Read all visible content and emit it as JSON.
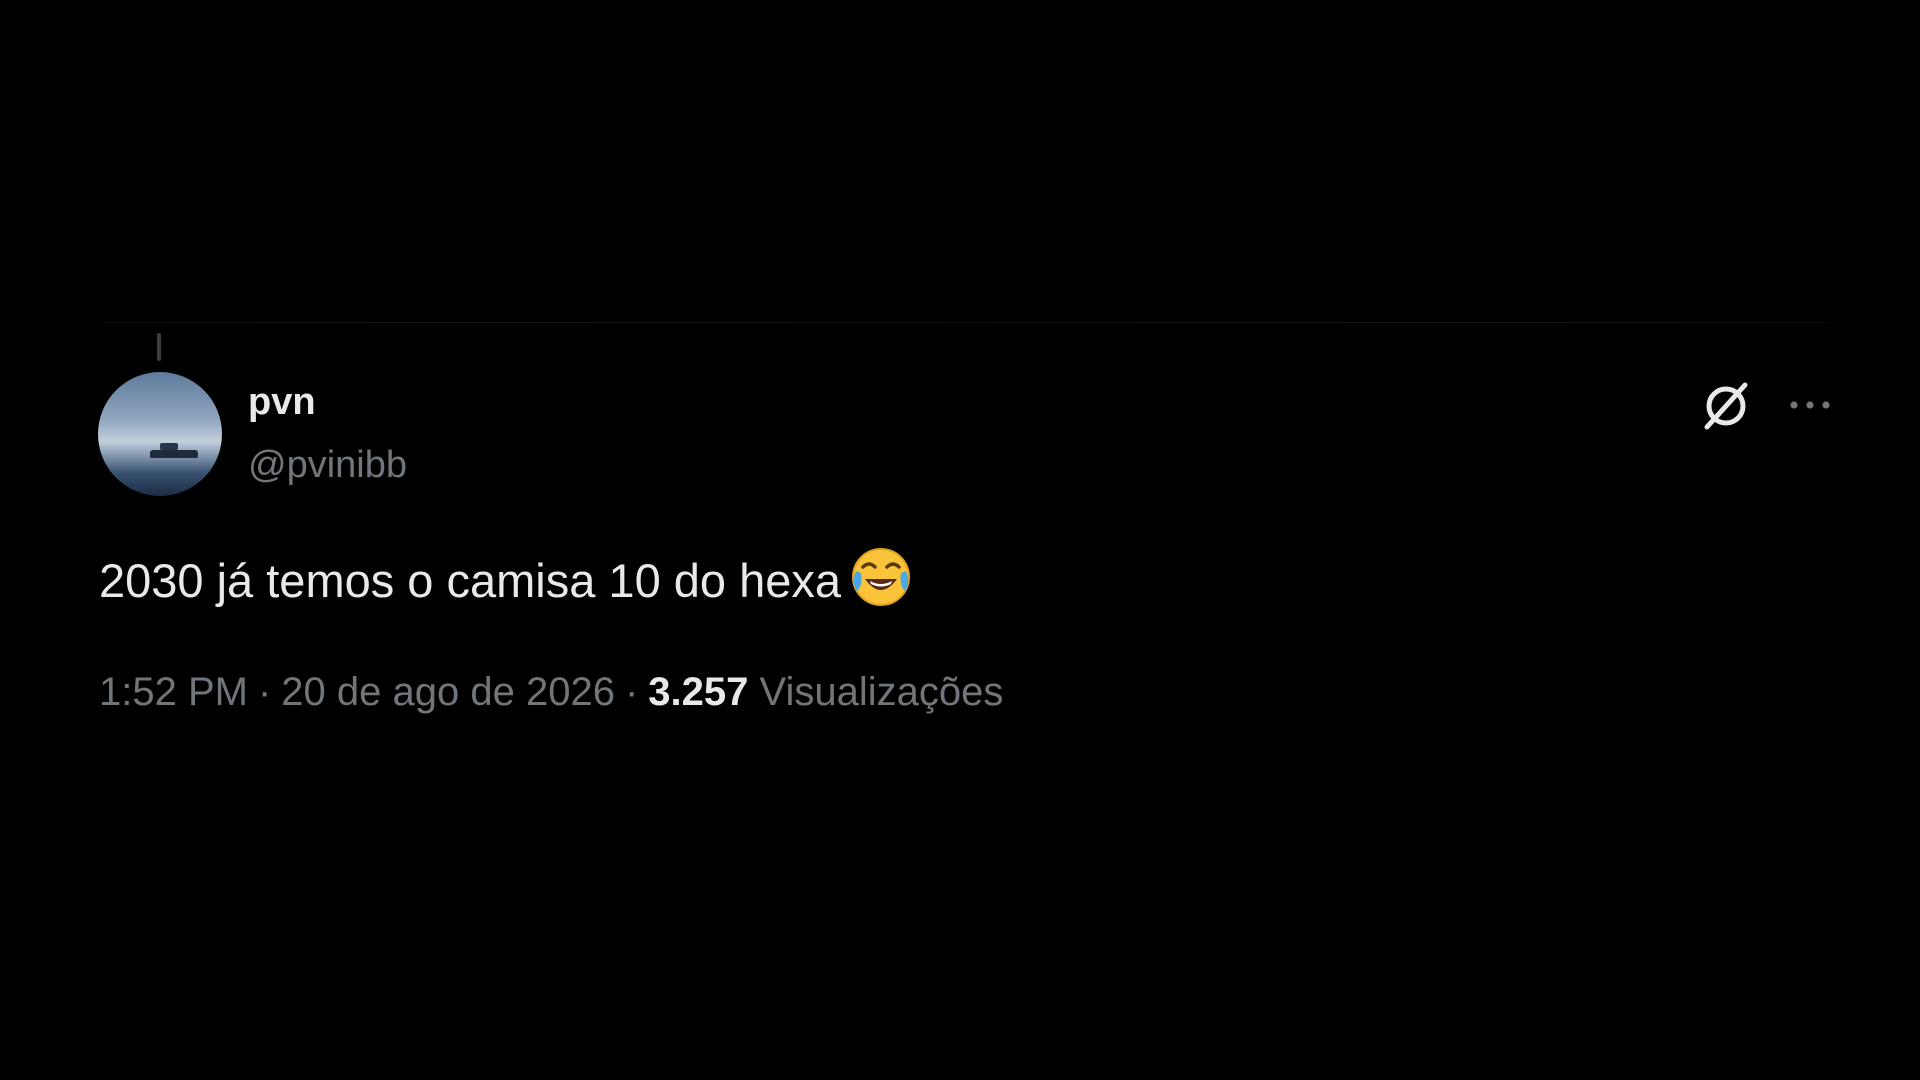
{
  "author": {
    "display_name": "pvn",
    "handle": "@pvinibb"
  },
  "tweet": {
    "text": "2030 já temos o camisa 10 do hexa",
    "emoji": "face-with-tears-of-joy"
  },
  "meta": {
    "time": "1:52 PM",
    "separator": "·",
    "date": "20 de ago de 2026",
    "views_count": "3.257",
    "views_label": "Visualizações"
  },
  "icons": {
    "grok": "grok-icon",
    "more": "more-horizontal-icon"
  },
  "colors": {
    "background": "#000000",
    "primary_text": "#e7e9ea",
    "secondary_text": "#71767b"
  }
}
